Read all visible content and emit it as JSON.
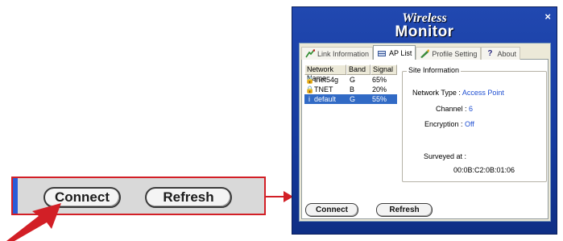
{
  "zoom": {
    "connect_label": "Connect",
    "refresh_label": "Refresh"
  },
  "window": {
    "logo_top": "Wireless",
    "logo_bottom": "Monitor",
    "close_label": "×"
  },
  "tabs": [
    {
      "label": "Link Information",
      "icon": "link-icon",
      "active": false
    },
    {
      "label": "AP List",
      "icon": "ap-list-icon",
      "active": true
    },
    {
      "label": "Profile Setting",
      "icon": "profile-icon",
      "active": false
    },
    {
      "label": "About",
      "icon": "question-icon",
      "active": false
    }
  ],
  "ap_list": {
    "headers": [
      "Network Name",
      "Band",
      "Signal"
    ],
    "rows": [
      {
        "name": "tnet54g",
        "band": "G",
        "signal": "65%",
        "icon": "secured-ap-icon",
        "selected": false
      },
      {
        "name": "TNET",
        "band": "B",
        "signal": "20%",
        "icon": "secured-ap-icon",
        "selected": false
      },
      {
        "name": "default",
        "band": "G",
        "signal": "55%",
        "icon": "open-ap-icon",
        "selected": true
      }
    ]
  },
  "site_info": {
    "legend": "Site Information",
    "network_type_label": "Network Type :",
    "network_type_value": "Access Point",
    "channel_label": "Channel :",
    "channel_value": "6",
    "encryption_label": "Encryption :",
    "encryption_value": "Off",
    "surveyed_label": "Surveyed at :",
    "mac": "00:0B:C2:0B:01:06"
  },
  "buttons": {
    "connect": "Connect",
    "refresh": "Refresh"
  },
  "colors": {
    "callout_red": "#d21f26",
    "window_blue": "#143a9e",
    "selection_blue": "#316ac5",
    "value_blue": "#1f4fd1"
  }
}
